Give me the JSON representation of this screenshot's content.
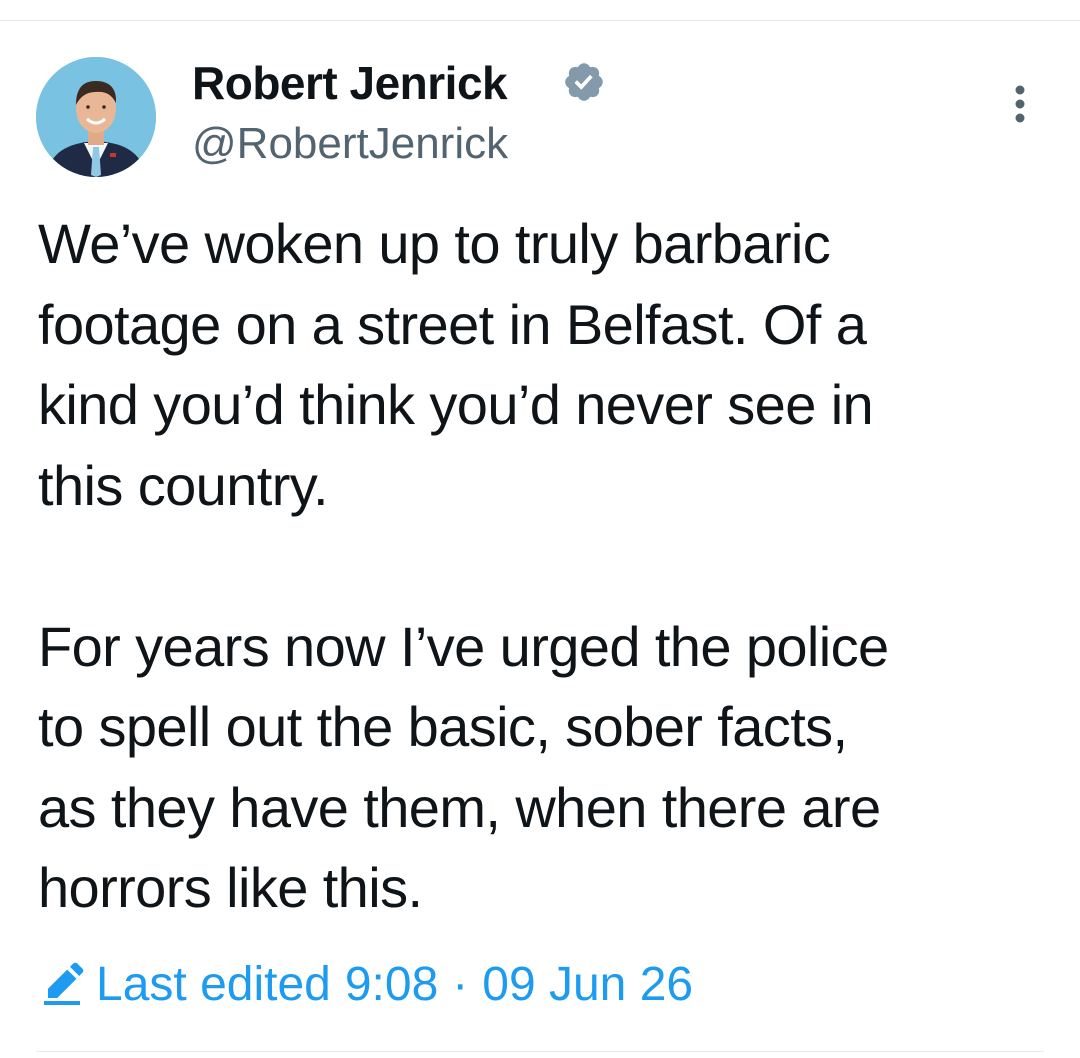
{
  "author": {
    "name": "Robert Jenrick",
    "handle": "@RobertJenrick",
    "verified": true
  },
  "tweet": {
    "lines": [
      "We’ve woken up to truly barbaric",
      "footage on a street in Belfast. Of a",
      "kind you’d think you’d never see in",
      "this country.",
      "",
      "For years now I’ve urged the police",
      "to spell out the basic, sober facts,",
      "as they have them, when there are",
      "horrors like this."
    ]
  },
  "edited": {
    "label": "Last edited",
    "time": "9:08",
    "separator": "·",
    "date": "09 Jun 26"
  },
  "icons": {
    "verified": "verified-badge-icon",
    "more": "more-options-icon",
    "edit": "pencil-edit-icon"
  },
  "colors": {
    "text": "#0f1419",
    "secondary": "#536471",
    "accent": "#1d9bf0",
    "badge": "#829aab",
    "divider": "#e7e9ea"
  }
}
